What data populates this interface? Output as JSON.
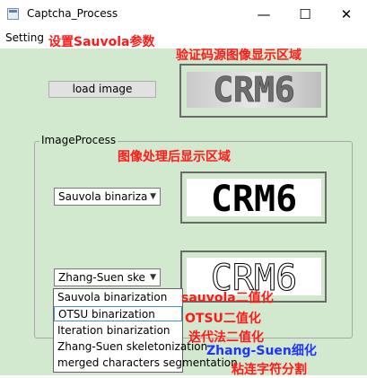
{
  "window": {
    "title": "Captcha_Process",
    "minimize": "—",
    "maximize": "☐",
    "close": "✕"
  },
  "menu": {
    "setting": "Setting"
  },
  "annotations": {
    "sauvola_params": "设置Sauvola参数",
    "source_area": "验证码源图像显示区域",
    "processed_area": "图像处理后显示区域",
    "sauvola_binarize": "sauvola二值化",
    "otsu_binarize": "OTSU二值化",
    "iterative_binarize": "迭代法二值化",
    "zhang_suen_thin": "Zhang-Suen细化",
    "split_chars": "粘连字符分割"
  },
  "load_button": "load image",
  "group_title": "ImageProcess",
  "combo1": {
    "value": "Sauvola binariza"
  },
  "combo2": {
    "value": "Zhang-Suen ske"
  },
  "captcha_text": {
    "source": "CRM6",
    "binary": "CRM6",
    "skeleton": "CRM6"
  },
  "dropdown_items": [
    "Sauvola binarization",
    "OTSU binarization",
    "Iteration binarization",
    "Zhang-Suen skeletonization",
    "merged characters segmentation"
  ],
  "colors": {
    "client_bg": "#d2e8cf",
    "annotation_red": "#ff1a1a",
    "annotation_blue": "#1f35ff",
    "dropdown_highlight": "#4b8dd6"
  }
}
